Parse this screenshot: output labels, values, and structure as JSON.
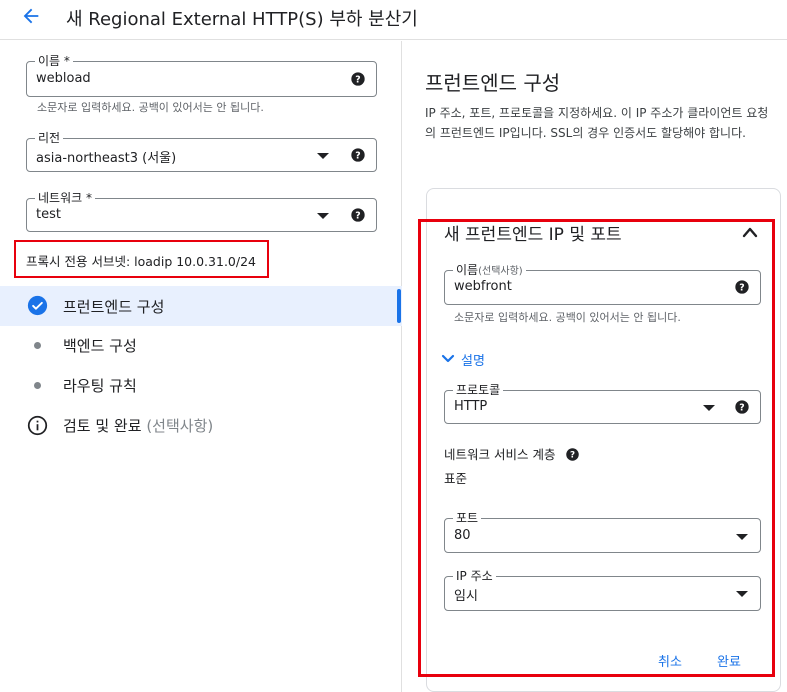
{
  "header": {
    "title": "새 Regional External HTTP(S) 부하 분산기"
  },
  "left": {
    "name_field": {
      "label": "이름",
      "required": "*",
      "value": "webload",
      "hint": "소문자로 입력하세요. 공백이 있어서는 안 됩니다."
    },
    "region_field": {
      "label": "리전",
      "value": "asia-northeast3 (서울)"
    },
    "network_field": {
      "label": "네트워크",
      "required": "*",
      "value": "test"
    },
    "proxy_subnet": "프록시 전용 서브넷: loadip 10.0.31.0/24",
    "steps": [
      {
        "label": "프런트엔드 구성",
        "state": "done"
      },
      {
        "label": "백엔드 구성",
        "state": "pending"
      },
      {
        "label": "라우팅 규칙",
        "state": "pending"
      },
      {
        "label": "검토 및 완료",
        "optional": "(선택사항)",
        "state": "info"
      }
    ]
  },
  "right": {
    "title": "프런트엔드 구성",
    "description": "IP 주소, 포트, 프로토콜을 지정하세요. 이 IP 주소가 클라이언트 요청의 프런트엔드 IP입니다. SSL의 경우 인증서도 할당해야 합니다.",
    "card": {
      "title": "새 프런트엔드 IP 및 포트",
      "name_field": {
        "label": "이름",
        "optional": "(선택사항)",
        "value": "webfront",
        "hint": "소문자로 입력하세요. 공백이 있어서는 안 됩니다."
      },
      "description_toggle": "설명",
      "protocol_field": {
        "label": "프로토콜",
        "value": "HTTP"
      },
      "network_tier": {
        "label": "네트워크 서비스 계층",
        "value": "표준"
      },
      "port_field": {
        "label": "포트",
        "value": "80"
      },
      "ip_field": {
        "label": "IP 주소",
        "value": "임시"
      },
      "cancel_label": "취소",
      "done_label": "완료"
    }
  },
  "colors": {
    "accent": "#1a73e8",
    "highlight_border": "#e8000d",
    "active_step_bg": "#e8f0fe"
  }
}
